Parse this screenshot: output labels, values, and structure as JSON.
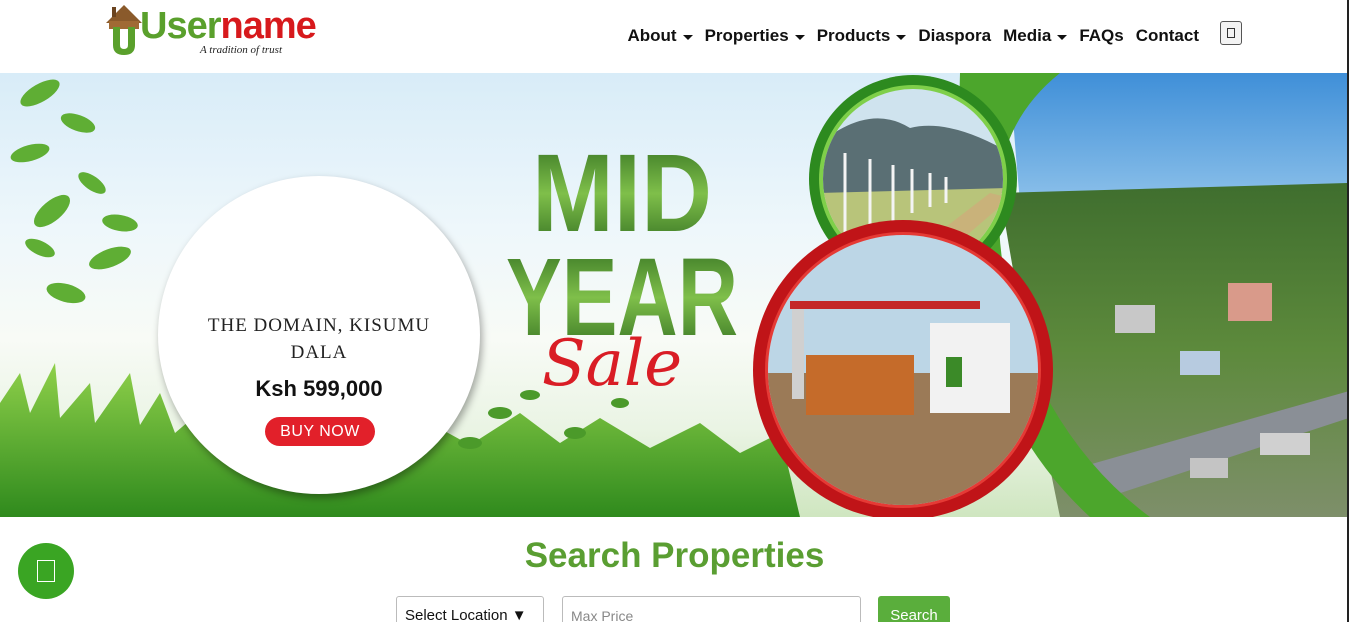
{
  "brand": {
    "name_part1": "User",
    "name_part2": "name",
    "tagline": "A tradition of trust"
  },
  "nav": {
    "items": [
      {
        "label": "About",
        "dropdown": true
      },
      {
        "label": "Properties",
        "dropdown": true
      },
      {
        "label": "Products",
        "dropdown": true
      },
      {
        "label": "Diaspora",
        "dropdown": false
      },
      {
        "label": "Media",
        "dropdown": true
      },
      {
        "label": "FAQs",
        "dropdown": false
      },
      {
        "label": "Contact",
        "dropdown": false
      }
    ],
    "toggle_icon": "menu-icon"
  },
  "hero": {
    "banner_line1": "MID",
    "banner_line2": "YEAR",
    "banner_script": "Sale",
    "property_title_line1": "THE DOMAIN, KISUMU",
    "property_title_line2": "DALA",
    "price": "Ksh 599,000",
    "cta_label": "BUY NOW"
  },
  "search": {
    "title": "Search Properties",
    "location_select": "Select Location ▼",
    "price_placeholder": "Max Price",
    "button_label": "Search"
  },
  "chat": {
    "icon": "chat-icon"
  },
  "colors": {
    "brand_green": "#5aa02c",
    "brand_red": "#d7191c",
    "cta_red": "#e2202a",
    "chat_green": "#3aa523"
  }
}
